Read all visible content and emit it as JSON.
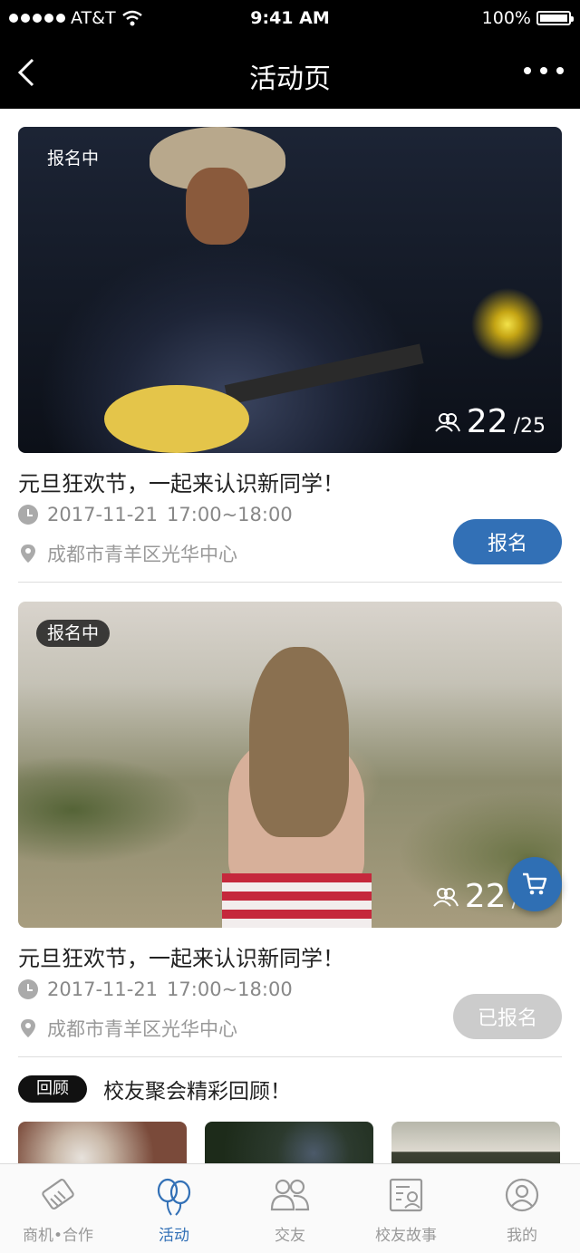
{
  "status_bar": {
    "carrier": "AT&T",
    "time": "9:41 AM",
    "battery": "100%"
  },
  "nav": {
    "title": "活动页"
  },
  "activities": [
    {
      "status": "报名中",
      "title": "元旦狂欢节，一起来认识新同学！",
      "date": "2017-11-21",
      "time_range": "17:00~18:00",
      "location": "成都市青羊区光华中心",
      "enrolled": "22",
      "capacity": "/25",
      "action": "报名"
    },
    {
      "status": "报名中",
      "title": "元旦狂欢节，一起来认识新同学！",
      "date": "2017-11-21",
      "time_range": "17:00~18:00",
      "location": "成都市青羊区光华中心",
      "enrolled": "22",
      "capacity": "/",
      "action": "已报名"
    }
  ],
  "review": {
    "tag": "回顾",
    "title": "校友聚会精彩回顾！"
  },
  "tabs": [
    {
      "label": "商机•合作",
      "icon": "handshake-icon"
    },
    {
      "label": "活动",
      "icon": "balloon-icon",
      "active": true
    },
    {
      "label": "交友",
      "icon": "friends-icon"
    },
    {
      "label": "校友故事",
      "icon": "story-icon"
    },
    {
      "label": "我的",
      "icon": "profile-icon"
    }
  ],
  "colors": {
    "accent": "#3270b6",
    "disabled": "#cccccc",
    "nav_bg": "#000000"
  }
}
